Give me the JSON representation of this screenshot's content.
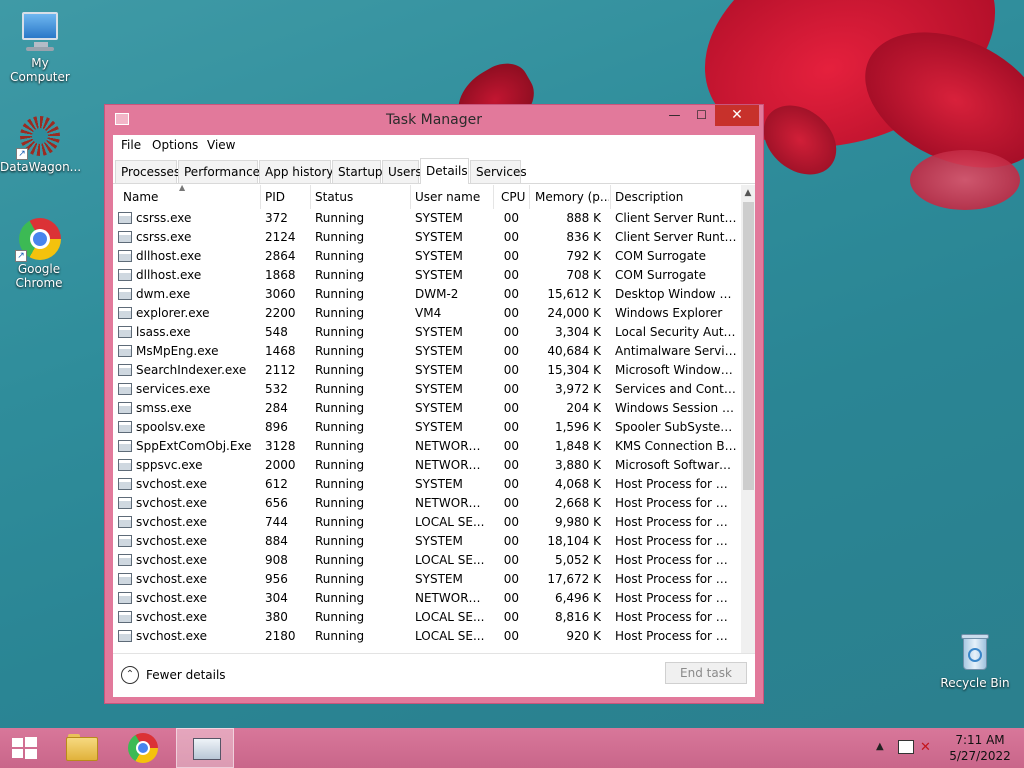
{
  "desktop": {
    "icons": [
      {
        "label": "My Computer"
      },
      {
        "label": "DataWagon..."
      },
      {
        "label": "Google Chrome"
      },
      {
        "label": "Recycle Bin"
      }
    ]
  },
  "window": {
    "title": "Task Manager",
    "controls": {
      "minimize": "—",
      "maximize": "☐",
      "close": "✕"
    },
    "menu": [
      "File",
      "Options",
      "View"
    ],
    "tabs": [
      "Processes",
      "Performance",
      "App history",
      "Startup",
      "Users",
      "Details",
      "Services"
    ],
    "active_tab": "Details",
    "columns": [
      "Name",
      "PID",
      "Status",
      "User name",
      "CPU",
      "Memory (p...",
      "Description"
    ],
    "rows": [
      {
        "name": "csrss.exe",
        "pid": "372",
        "status": "Running",
        "user": "SYSTEM",
        "cpu": "00",
        "mem": "888 K",
        "desc": "Client Server Runtim..."
      },
      {
        "name": "csrss.exe",
        "pid": "2124",
        "status": "Running",
        "user": "SYSTEM",
        "cpu": "00",
        "mem": "836 K",
        "desc": "Client Server Runtim..."
      },
      {
        "name": "dllhost.exe",
        "pid": "2864",
        "status": "Running",
        "user": "SYSTEM",
        "cpu": "00",
        "mem": "792 K",
        "desc": "COM Surrogate"
      },
      {
        "name": "dllhost.exe",
        "pid": "1868",
        "status": "Running",
        "user": "SYSTEM",
        "cpu": "00",
        "mem": "708 K",
        "desc": "COM Surrogate"
      },
      {
        "name": "dwm.exe",
        "pid": "3060",
        "status": "Running",
        "user": "DWM-2",
        "cpu": "00",
        "mem": "15,612 K",
        "desc": "Desktop Window M..."
      },
      {
        "name": "explorer.exe",
        "pid": "2200",
        "status": "Running",
        "user": "VM4",
        "cpu": "00",
        "mem": "24,000 K",
        "desc": "Windows Explorer"
      },
      {
        "name": "lsass.exe",
        "pid": "548",
        "status": "Running",
        "user": "SYSTEM",
        "cpu": "00",
        "mem": "3,304 K",
        "desc": "Local Security Auth..."
      },
      {
        "name": "MsMpEng.exe",
        "pid": "1468",
        "status": "Running",
        "user": "SYSTEM",
        "cpu": "00",
        "mem": "40,684 K",
        "desc": "Antimalware Service..."
      },
      {
        "name": "SearchIndexer.exe",
        "pid": "2112",
        "status": "Running",
        "user": "SYSTEM",
        "cpu": "00",
        "mem": "15,304 K",
        "desc": "Microsoft Windows ..."
      },
      {
        "name": "services.exe",
        "pid": "532",
        "status": "Running",
        "user": "SYSTEM",
        "cpu": "00",
        "mem": "3,972 K",
        "desc": "Services and Control..."
      },
      {
        "name": "smss.exe",
        "pid": "284",
        "status": "Running",
        "user": "SYSTEM",
        "cpu": "00",
        "mem": "204 K",
        "desc": "Windows Session M..."
      },
      {
        "name": "spoolsv.exe",
        "pid": "896",
        "status": "Running",
        "user": "SYSTEM",
        "cpu": "00",
        "mem": "1,596 K",
        "desc": "Spooler SubSystem ..."
      },
      {
        "name": "SppExtComObj.Exe",
        "pid": "3128",
        "status": "Running",
        "user": "NETWORK...",
        "cpu": "00",
        "mem": "1,848 K",
        "desc": "KMS Connection Br..."
      },
      {
        "name": "sppsvc.exe",
        "pid": "2000",
        "status": "Running",
        "user": "NETWORK...",
        "cpu": "00",
        "mem": "3,880 K",
        "desc": "Microsoft Software ..."
      },
      {
        "name": "svchost.exe",
        "pid": "612",
        "status": "Running",
        "user": "SYSTEM",
        "cpu": "00",
        "mem": "4,068 K",
        "desc": "Host Process for Wi..."
      },
      {
        "name": "svchost.exe",
        "pid": "656",
        "status": "Running",
        "user": "NETWORK...",
        "cpu": "00",
        "mem": "2,668 K",
        "desc": "Host Process for Wi..."
      },
      {
        "name": "svchost.exe",
        "pid": "744",
        "status": "Running",
        "user": "LOCAL SE...",
        "cpu": "00",
        "mem": "9,980 K",
        "desc": "Host Process for Wi..."
      },
      {
        "name": "svchost.exe",
        "pid": "884",
        "status": "Running",
        "user": "SYSTEM",
        "cpu": "00",
        "mem": "18,104 K",
        "desc": "Host Process for Wi..."
      },
      {
        "name": "svchost.exe",
        "pid": "908",
        "status": "Running",
        "user": "LOCAL SE...",
        "cpu": "00",
        "mem": "5,052 K",
        "desc": "Host Process for Wi..."
      },
      {
        "name": "svchost.exe",
        "pid": "956",
        "status": "Running",
        "user": "SYSTEM",
        "cpu": "00",
        "mem": "17,672 K",
        "desc": "Host Process for Wi..."
      },
      {
        "name": "svchost.exe",
        "pid": "304",
        "status": "Running",
        "user": "NETWORK...",
        "cpu": "00",
        "mem": "6,496 K",
        "desc": "Host Process for Wi..."
      },
      {
        "name": "svchost.exe",
        "pid": "380",
        "status": "Running",
        "user": "LOCAL SE...",
        "cpu": "00",
        "mem": "8,816 K",
        "desc": "Host Process for Wi..."
      },
      {
        "name": "svchost.exe",
        "pid": "2180",
        "status": "Running",
        "user": "LOCAL SE...",
        "cpu": "00",
        "mem": "920 K",
        "desc": "Host Process for Wi..."
      }
    ],
    "footer": {
      "fewer_details": "Fewer details",
      "end_task": "End task"
    }
  },
  "taskbar": {
    "clock_time": "7:11 AM",
    "clock_date": "5/27/2022"
  },
  "colors": {
    "window_frame": "#e2799b",
    "close_button": "#c7312b",
    "taskbar": "#d8779a"
  }
}
